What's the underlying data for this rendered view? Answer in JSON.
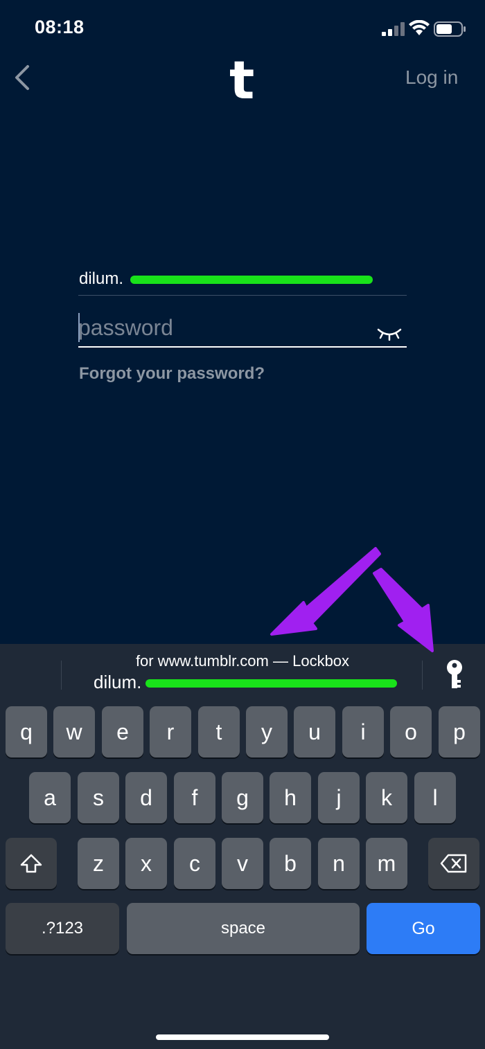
{
  "status_bar": {
    "time": "08:18"
  },
  "nav": {
    "logo": "t",
    "login_label": "Log in"
  },
  "form": {
    "email_value": "dilum.",
    "password_placeholder": "password",
    "forgot_label": "Forgot your password?"
  },
  "quicktype": {
    "source_label": "for www.tumblr.com — Lockbox",
    "username": "dilum."
  },
  "keyboard": {
    "row1": [
      "q",
      "w",
      "e",
      "r",
      "t",
      "y",
      "u",
      "i",
      "o",
      "p"
    ],
    "row2": [
      "a",
      "s",
      "d",
      "f",
      "g",
      "h",
      "j",
      "k",
      "l"
    ],
    "row3": [
      "z",
      "x",
      "c",
      "v",
      "b",
      "n",
      "m"
    ],
    "numbers_label": ".?123",
    "space_label": "space",
    "go_label": "Go"
  },
  "colors": {
    "background": "#001935",
    "keyboard_bg": "#1f2937",
    "key": "#5a6068",
    "go_key": "#2d7cf6",
    "redaction": "#19e21a",
    "annotation": "#a020f0"
  }
}
